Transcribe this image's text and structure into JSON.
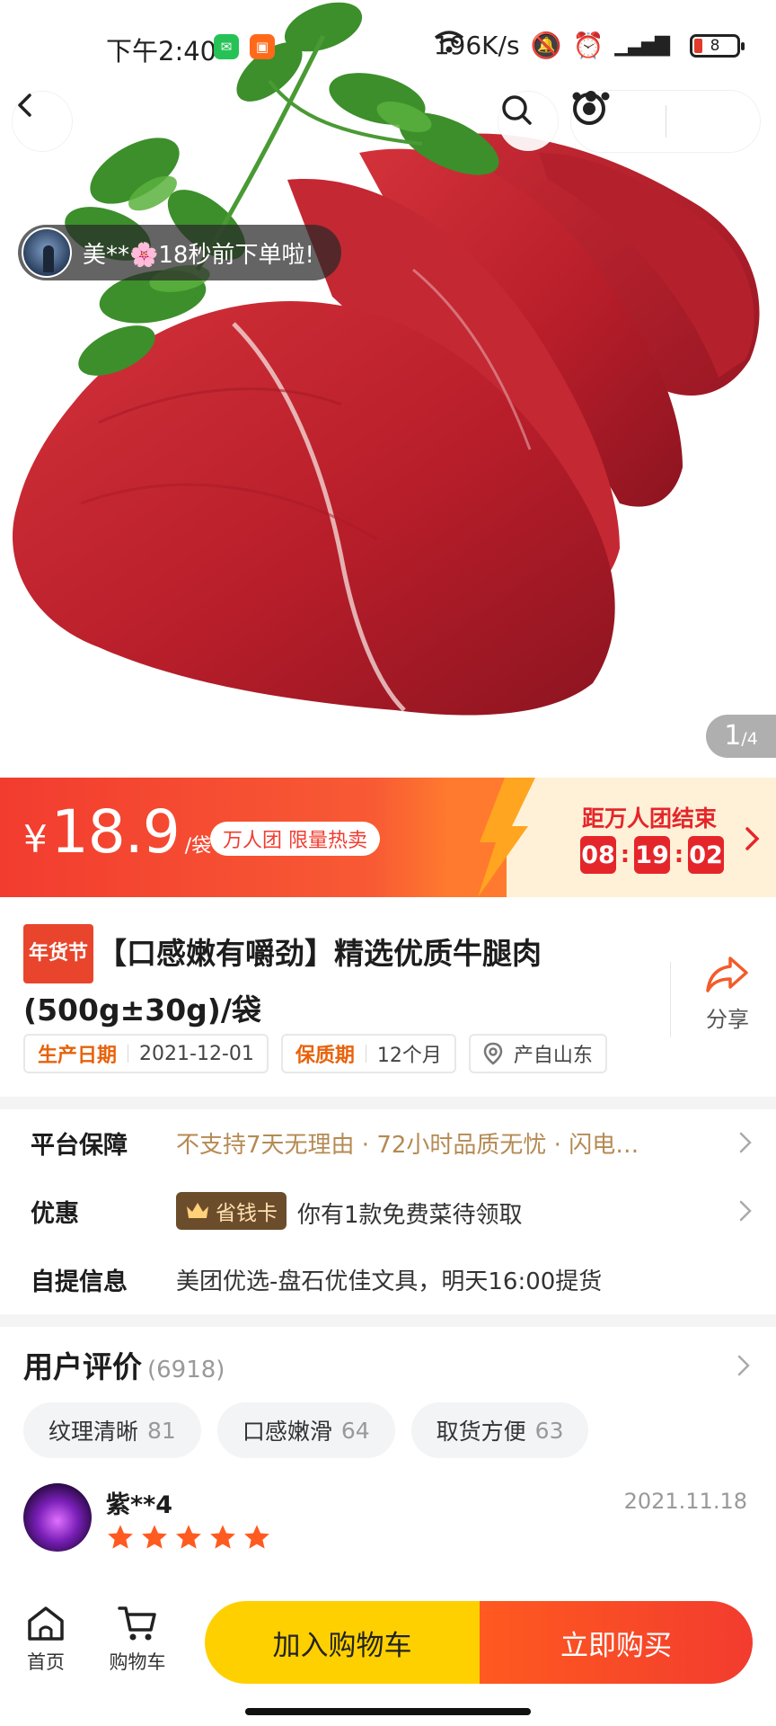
{
  "status_bar": {
    "time": "下午2:40",
    "app_badges": [
      "wechat-icon",
      "app-icon"
    ],
    "network_speed": "196K/s",
    "battery_level": "8"
  },
  "nav": {
    "back_icon": "chevron-left-icon",
    "search_icon": "search-icon",
    "more_icon": "more-dots-icon",
    "close_icon": "target-icon"
  },
  "hero": {
    "ticker_text": "美**🌸18秒前下单啦!",
    "pager_current": "1",
    "pager_total": "/4"
  },
  "price_bar": {
    "currency": "¥",
    "price": "18.9",
    "unit": "/袋",
    "promo_pill": "万人团 限量热卖",
    "countdown_title": "距万人团结束",
    "countdown": {
      "h": "08",
      "m": "19",
      "s": "02"
    },
    "colors": {
      "accent": "#f23c2f",
      "countdown_red": "#e4262a",
      "panel": "#fff1d8"
    }
  },
  "product": {
    "festival_tag": "年货节",
    "title": "【口感嫩有嚼劲】精选优质牛腿肉 (500g±30g)/袋",
    "share_label": "分享",
    "attributes": [
      {
        "key": "生产日期",
        "value": "2021-12-01"
      },
      {
        "key": "保质期",
        "value": "12个月"
      }
    ],
    "origin": "产自山东"
  },
  "info": {
    "guarantee_key": "平台保障",
    "guarantee_value": "不支持7天无理由 · 72小时品质无忧 · 闪电…",
    "discount_key": "优惠",
    "discount_badge": "省钱卡",
    "discount_value": "你有1款免费菜待领取",
    "pickup_key": "自提信息",
    "pickup_value": "美团优选-盘石优佳文具，明天16:00提货"
  },
  "reviews": {
    "title": "用户评价",
    "count": "(6918)",
    "tags": [
      {
        "label": "纹理清晰",
        "count": "81"
      },
      {
        "label": "口感嫩滑",
        "count": "64"
      },
      {
        "label": "取货方便",
        "count": "63"
      }
    ],
    "first": {
      "name": "紫**4",
      "date": "2021.11.18",
      "rating": 5
    }
  },
  "bottom_bar": {
    "home_label": "首页",
    "cart_label": "购物车",
    "add_to_cart": "加入购物车",
    "buy_now": "立即购买",
    "colors": {
      "cart_button": "#ffd000",
      "buy_button": "#f23c2f"
    }
  }
}
